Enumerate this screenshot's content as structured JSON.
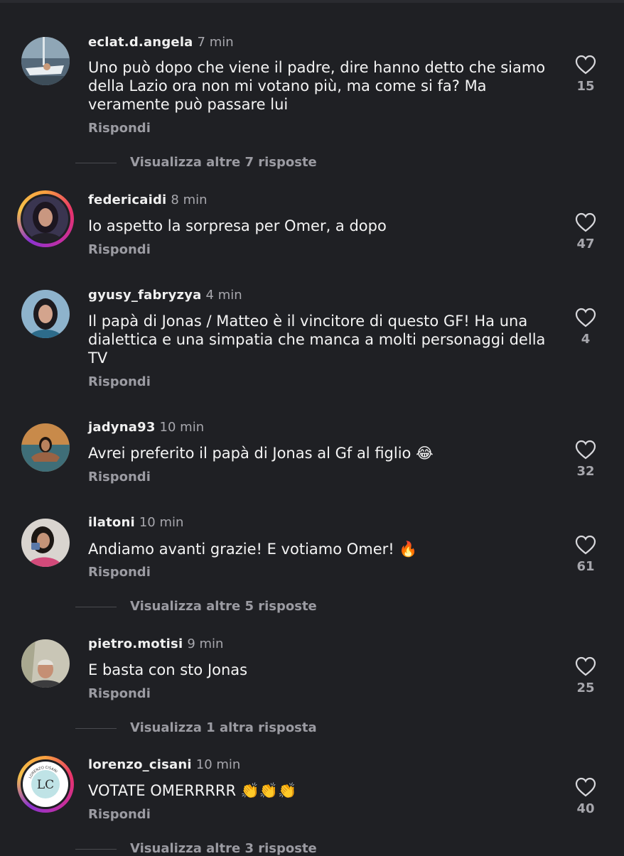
{
  "comments": [
    {
      "username": "eclat.d.angela",
      "time": "7 min",
      "text": "Uno può dopo che viene il padre, dire hanno detto che siamo della Lazio ora non mi votano più, ma come si fa? Ma veramente può passare lui",
      "reply": "Rispondi",
      "likes": "15",
      "more_replies": "Visualizza altre 7 risposte",
      "avatar_icon": "boat-photo"
    },
    {
      "username": "federicaidi",
      "time": "8 min",
      "text": "Io aspetto la sorpresa per Omer, a dopo",
      "reply": "Rispondi",
      "likes": "47",
      "avatar_icon": "woman-portrait"
    },
    {
      "username": "gyusy_fabryzya",
      "time": "4 min",
      "text": "Il papà di Jonas / Matteo è il vincitore di questo GF! Ha una dialettica e una simpatia che manca a molti personaggi della TV",
      "reply": "Rispondi",
      "likes": "4",
      "avatar_icon": "woman-portrait"
    },
    {
      "username": "jadyna93",
      "time": "10 min",
      "text": "Avrei preferito il papà di Jonas al Gf al figlio 😂",
      "reply": "Rispondi",
      "likes": "32",
      "avatar_icon": "sea-photo"
    },
    {
      "username": "ilatoni",
      "time": "10 min",
      "text": "Andiamo avanti grazie! E votiamo Omer! 🔥",
      "reply": "Rispondi",
      "likes": "61",
      "more_replies": "Visualizza altre 5 risposte",
      "avatar_icon": "woman-portrait"
    },
    {
      "username": "pietro.motisi",
      "time": "9 min",
      "text": "E basta con sto Jonas",
      "reply": "Rispondi",
      "likes": "25",
      "more_replies": "Visualizza 1 altra risposta",
      "avatar_icon": "man-portrait"
    },
    {
      "username": "lorenzo_cisani",
      "time": "10 min",
      "text": "VOTATE OMERRRRR 👏👏👏",
      "reply": "Rispondi",
      "likes": "40",
      "more_replies": "Visualizza altre 3 risposte",
      "avatar_icon": "lc-logo",
      "avatar_logo_text": "LC",
      "avatar_logo_ring": "LORENZO CISANI"
    }
  ],
  "colors": {
    "background": "#1f2024",
    "muted": "#9b9ba2",
    "text": "#f4f4f4"
  }
}
